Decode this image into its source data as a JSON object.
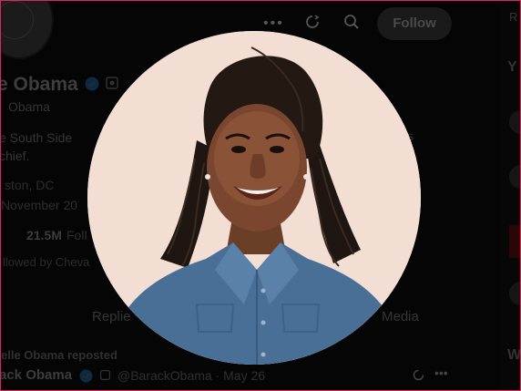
{
  "header": {
    "follow_label": "Follow"
  },
  "profile": {
    "display_name": "e Obama",
    "handle": "Obama",
    "bio_left": "e South Side",
    "bio_line2": "chief.",
    "bio_right": "s",
    "location": "ston, DC",
    "joined": "November 20",
    "followers_count": "21.5M",
    "followers_label": "Foll",
    "followed_by": "llowed by Cheva"
  },
  "tabs": {
    "replies": "Replie",
    "media": "Media"
  },
  "post": {
    "repost_text": "elle Obama reposted",
    "author": "ack Obama",
    "meta": "@BarackObama · May 26"
  },
  "right_column": {
    "letter_top": "R",
    "letter_mid": "Y",
    "letter_bottom": "W"
  },
  "colors": {
    "modal_backdrop": "#0a0a0a",
    "photo_background": "#f3ded3",
    "denim": "#4a6f97",
    "accent_border": "#e0245e"
  },
  "icons": {
    "more": "more-horizontal-icon",
    "refresh": "refresh-icon",
    "search": "search-icon",
    "verified": "verified-badge-icon",
    "affiliate": "affiliate-badge-icon"
  }
}
